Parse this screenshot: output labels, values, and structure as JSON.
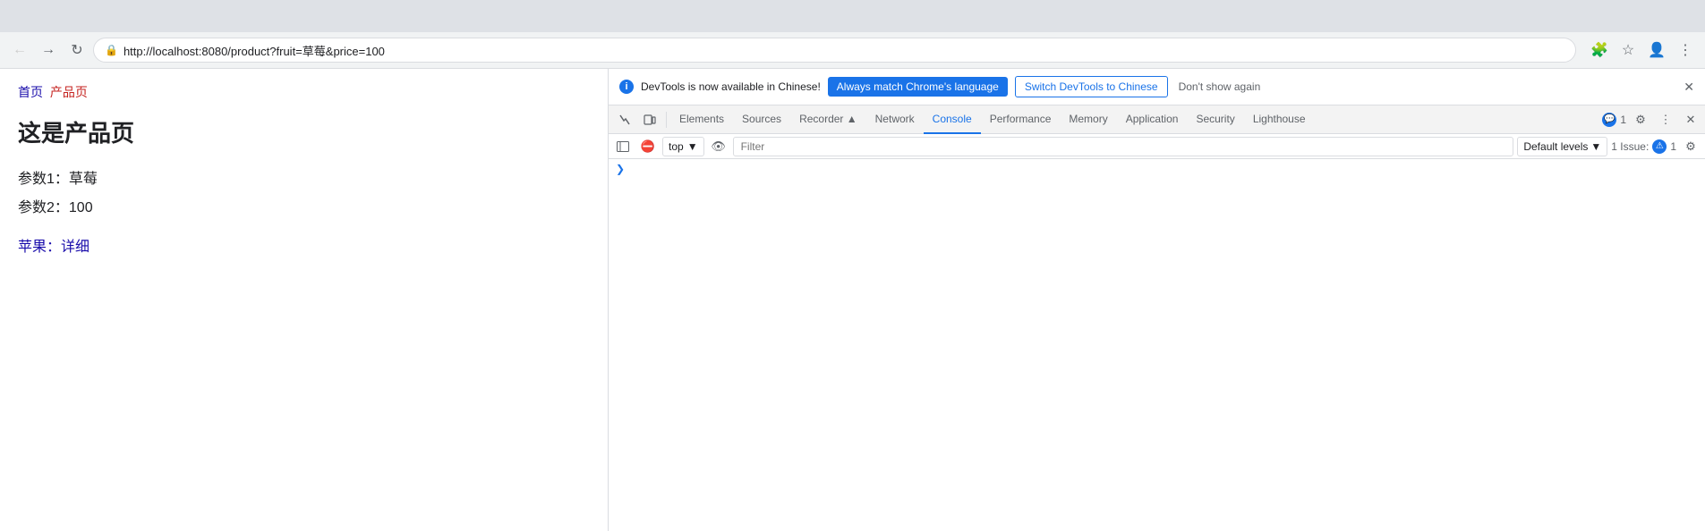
{
  "browser": {
    "url": "http://localhost:8080/product?fruit=草莓&price=100",
    "back_btn": "◀",
    "forward_btn": "▶",
    "reload_btn": "↻",
    "lock_icon": "🔒",
    "extensions_icon": "🧩",
    "bookmark_icon": "☆",
    "profile_icon": "👤",
    "menu_icon": "⋮"
  },
  "page": {
    "breadcrumb_home": "首页",
    "breadcrumb_sep": " ",
    "breadcrumb_current": "产品页",
    "title": "这是产品页",
    "param1_label": "参数1：草莓",
    "param2_label": "参数2：100",
    "apple_link": "苹果：详细"
  },
  "devtools": {
    "notification": {
      "text": "DevTools is now available in Chinese!",
      "btn_always": "Always match Chrome's language",
      "btn_switch": "Switch DevTools to Chinese",
      "dont_show": "Don't show again",
      "close": "✕"
    },
    "tabs": [
      {
        "label": "Elements",
        "active": false
      },
      {
        "label": "Sources",
        "active": false
      },
      {
        "label": "Recorder ▲",
        "active": false
      },
      {
        "label": "Network",
        "active": false
      },
      {
        "label": "Console",
        "active": true
      },
      {
        "label": "Performance",
        "active": false
      },
      {
        "label": "Memory",
        "active": false
      },
      {
        "label": "Application",
        "active": false
      },
      {
        "label": "Security",
        "active": false
      },
      {
        "label": "Lighthouse",
        "active": false
      }
    ],
    "messages_count": "1",
    "issues_label": "1 Issue:",
    "issues_count": "1",
    "console": {
      "top_label": "top",
      "filter_placeholder": "Filter",
      "default_levels": "Default levels",
      "chevron_down": "▾"
    }
  }
}
